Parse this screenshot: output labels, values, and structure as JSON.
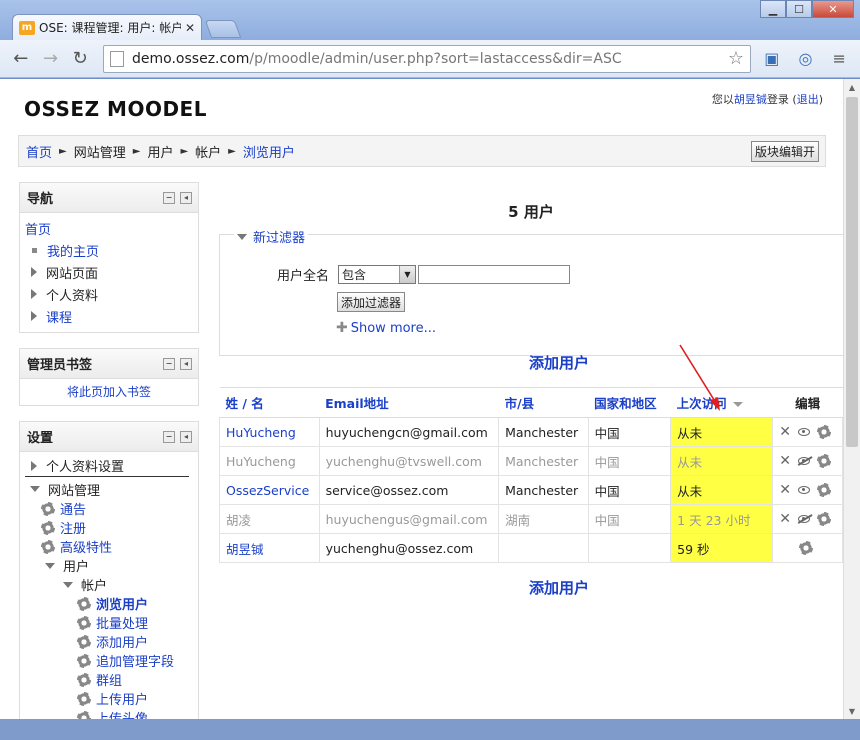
{
  "browser": {
    "tab_title": "OSE: 课程管理: 用户: 帐户",
    "favicon_text": "m",
    "url_host": "demo.ossez.com",
    "url_path": "/p/moodle/admin/user.php?sort=lastaccess&dir=ASC"
  },
  "header": {
    "site_name": "OSSEZ MOODEL",
    "login_prefix": "您以",
    "login_user": "胡昱铖",
    "login_mid": "登录 (",
    "logout": "退出",
    "login_suffix": ")"
  },
  "breadcrumb": {
    "items": [
      "首页",
      "网站管理",
      "用户",
      "帐户",
      "浏览用户"
    ],
    "separator": "►",
    "edit_button": "版块编辑开"
  },
  "nav_block": {
    "title": "导航",
    "home": "首页",
    "items": [
      "我的主页",
      "网站页面",
      "个人资料",
      "课程"
    ]
  },
  "admin_bookmarks": {
    "title": "管理员书签",
    "link": "将此页加入书签"
  },
  "settings_block": {
    "title": "设置",
    "profile_settings": "个人资料设置",
    "site_admin": "网站管理",
    "sub_items": [
      "通告",
      "注册",
      "高级特性"
    ],
    "users": "用户",
    "accounts": "帐户",
    "account_items": [
      "浏览用户",
      "批量处理",
      "添加用户",
      "追加管理字段",
      "群组",
      "上传用户",
      "上传头像"
    ]
  },
  "main": {
    "user_count": "5 用户",
    "filter": {
      "legend": "新过滤器",
      "label": "用户全名",
      "select_value": "包含",
      "input_value": "",
      "add_button": "添加过滤器",
      "show_more": "Show more..."
    },
    "add_user": "添加用户",
    "table": {
      "headers": {
        "last_name": "姓",
        "sep": " / ",
        "first_name": "名",
        "email": "Email地址",
        "city": "市/县",
        "country": "国家和地区",
        "last_access": "上次访问",
        "edit": "编辑"
      },
      "rows": [
        {
          "name": "HuYucheng",
          "email": "huyuchengcn@gmail.com",
          "city": "Manchester",
          "country": "中国",
          "last_access": "从未",
          "dim": false
        },
        {
          "name": "HuYucheng",
          "email": "yuchenghu@tvswell.com",
          "city": "Manchester",
          "country": "中国",
          "last_access": "从未",
          "dim": true
        },
        {
          "name": "OssezService",
          "email": "service@ossez.com",
          "city": "Manchester",
          "country": "中国",
          "last_access": "从未",
          "dim": false
        },
        {
          "name": "胡凌",
          "email": "huyuchengus@gmail.com",
          "city": "湖南",
          "country": "中国",
          "last_access": "1 天 23 小时",
          "dim": true
        },
        {
          "name": "胡昱铖",
          "email": "yuchenghu@ossez.com",
          "city": "",
          "country": "",
          "last_access": "59 秒",
          "dim": false
        }
      ]
    }
  },
  "colors": {
    "link": "#1a3fc8",
    "highlight": "#ffff44",
    "annotation_arrow": "#e02020"
  }
}
